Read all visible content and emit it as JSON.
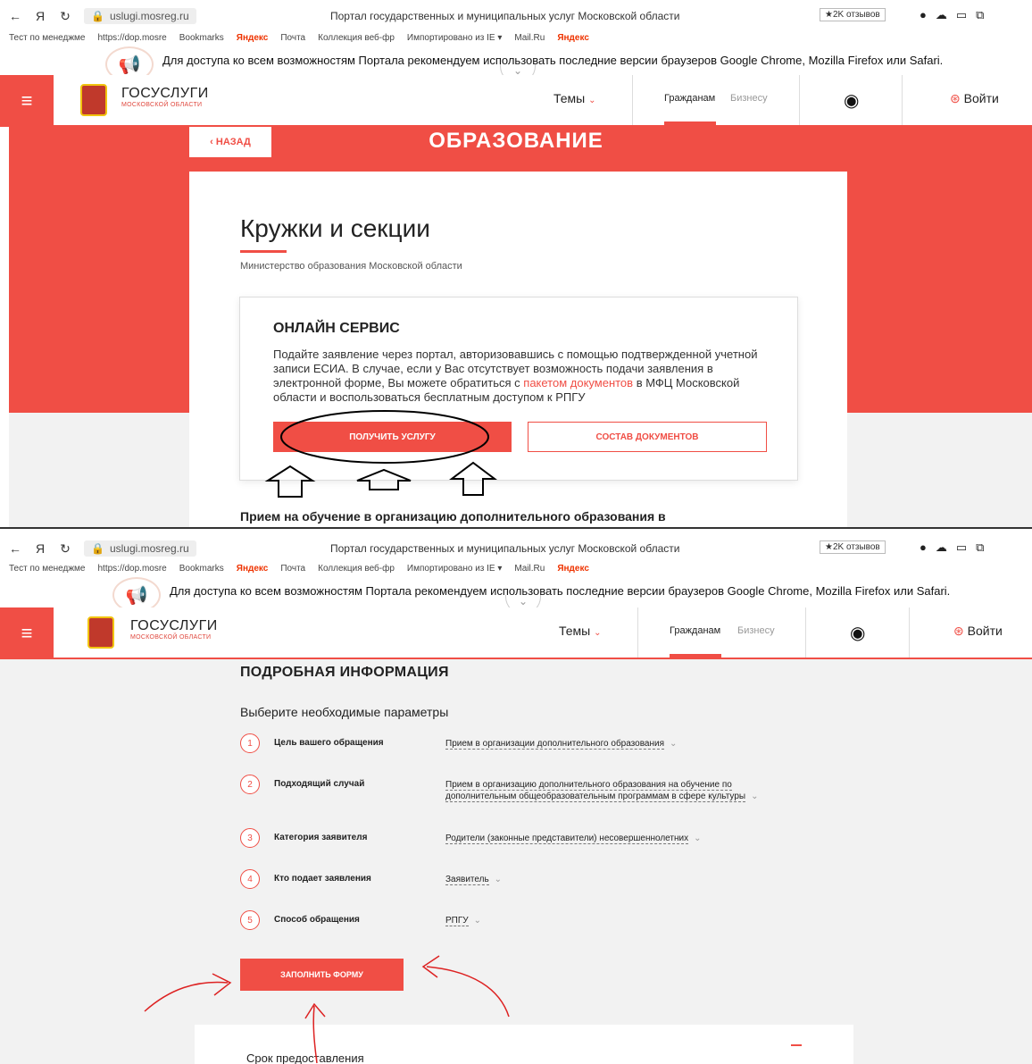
{
  "browser": {
    "url": "uslugi.mosreg.ru",
    "title": "Портал государственных и муниципальных услуг Московской области",
    "reviews": "★2K отзывов",
    "bookmarks": [
      "Тест по менеджме",
      "https://dop.mosre",
      "Bookmarks",
      "Яндекс",
      "Почта",
      "Коллекция веб-фр",
      "Импортировано из IE ▾",
      "Mail.Ru",
      "Яндекс"
    ]
  },
  "banner": {
    "message": "Для доступа ко всем возможностям Портала рекомендуем использовать последние версии браузеров Google Chrome, Mozilla Firefox или Safari."
  },
  "header": {
    "brand": "ГОСУСЛУГИ",
    "brand_sub": "МОСКОВСКОЙ ОБЛАСТИ",
    "themes": "Темы",
    "citizens": "Гражданам",
    "business": "Бизнесу",
    "login": "Войти"
  },
  "page1": {
    "back": "‹ НАЗАД",
    "section_title": "ОБРАЗОВАНИЕ",
    "service_title": "Кружки и секции",
    "ministry": "Министерство образования Московской области",
    "online_title": "ОНЛАЙН СЕРВИС",
    "online_text_1": "Подайте заявление через портал, авторизовавшись с помощью подтвержденной учетной записи ЕСИА. В случае, если у Вас отсутствует возможность подачи заявления в электронной форме, Вы можете обратиться с",
    "online_link": "пакетом документов",
    "online_text_2": "в МФЦ Московской области и воспользоваться бесплатным доступом к РПГУ",
    "get_service": "ПОЛУЧИТЬ УСЛУГУ",
    "documents": "СОСТАВ ДОКУМЕНТОВ",
    "priem": "Прием на обучение в организацию дополнительного образования в"
  },
  "page2": {
    "details_title": "ПОДРОБНАЯ ИНФОРМАЦИЯ",
    "select_title": "Выберите необходимые параметры",
    "params": [
      {
        "num": "1",
        "label": "Цель вашего обращения",
        "value": "Прием в организации дополнительного образования"
      },
      {
        "num": "2",
        "label": "Подходящий случай",
        "value": "Прием в организацию дополнительного образования на обучение по дополнительным общеобразовательным программам в сфере культуры"
      },
      {
        "num": "3",
        "label": "Категория заявителя",
        "value": "Родители (законные представители) несовершеннолетних"
      },
      {
        "num": "4",
        "label": "Кто подает заявления",
        "value": "Заявитель"
      },
      {
        "num": "5",
        "label": "Способ обращения",
        "value": "РПГУ"
      }
    ],
    "fill_form": "ЗАПОЛНИТЬ ФОРМУ",
    "term": "Срок предоставления"
  },
  "colors": {
    "accent": "#f04e45",
    "grey_bg": "#f2f2f2"
  }
}
